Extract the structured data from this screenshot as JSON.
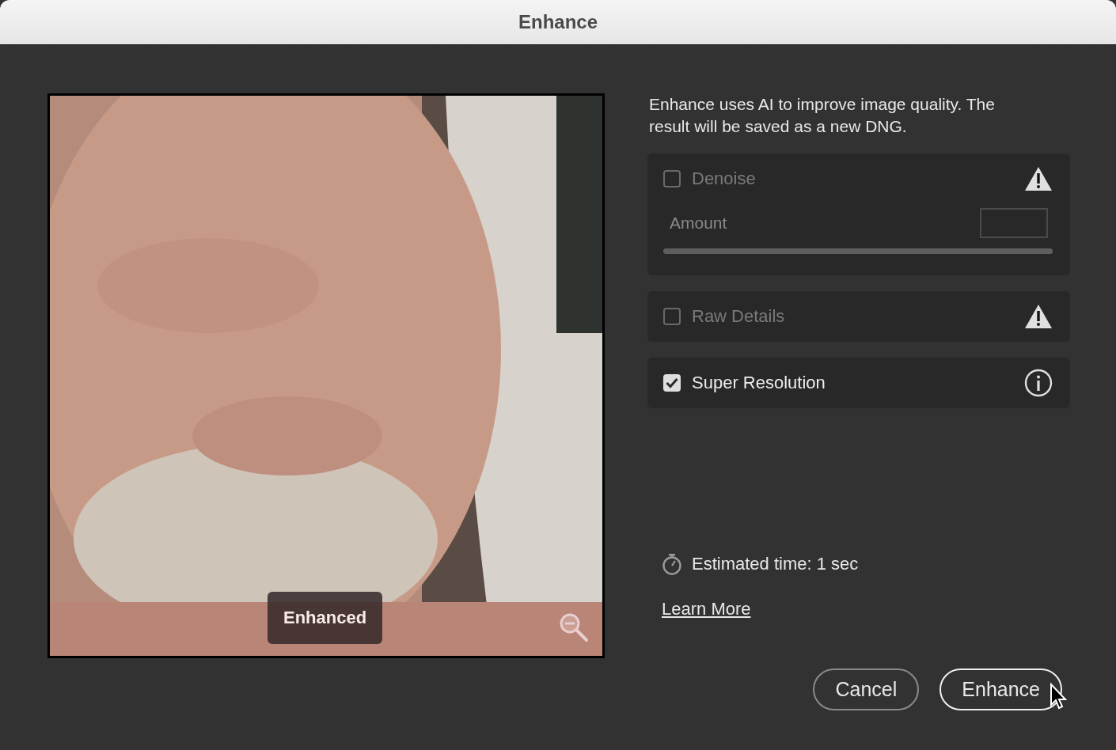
{
  "window": {
    "title": "Enhance"
  },
  "preview": {
    "badge": "Enhanced"
  },
  "description": "Enhance uses AI to improve image quality. The result will be saved as a new DNG.",
  "options": [
    {
      "kind": "slider",
      "label": "Denoise",
      "checked": false,
      "disabled": true,
      "warning": true,
      "amount_label": "Amount",
      "level": 1
    },
    {
      "kind": "plain",
      "label": "Raw Details",
      "checked": false,
      "disabled": true,
      "warning": true
    },
    {
      "kind": "plain",
      "label": "Super Resolution",
      "checked": true,
      "disabled": false,
      "warning": false
    }
  ],
  "estimate": "Estimated time: 1 sec",
  "link": "Learn More",
  "buttons": [
    {
      "label": "Cancel",
      "primary": false
    },
    {
      "label": "Enhance",
      "primary": true
    }
  ]
}
